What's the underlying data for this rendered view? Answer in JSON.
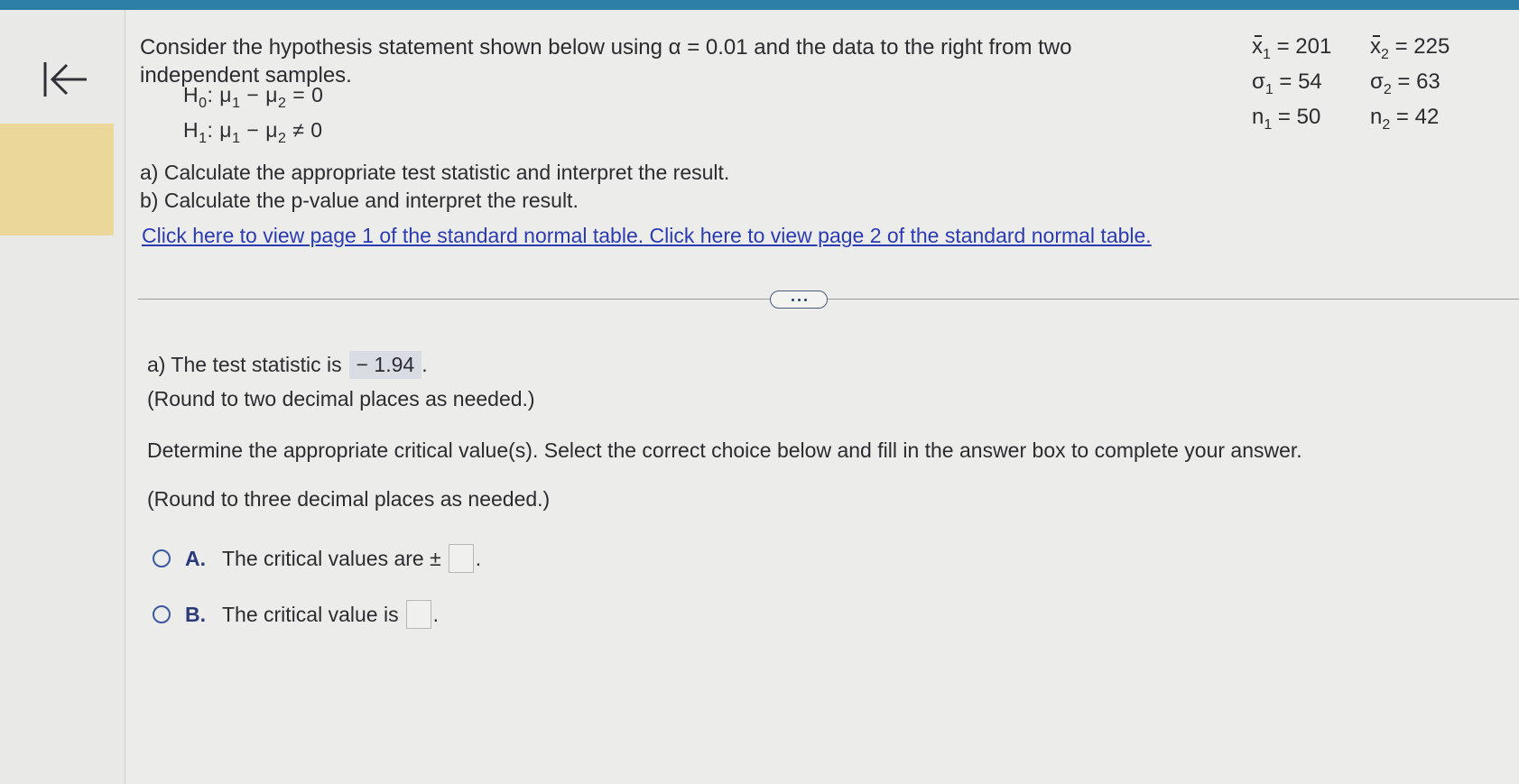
{
  "question": {
    "line1": "Consider the hypothesis statement shown below using α = 0.01 and the data to the right from two",
    "line2": "independent samples.",
    "h0_label": "H",
    "h0_sub": "0",
    "h0_rest": ": μ",
    "h0_mu1_sub": "1",
    "h0_minus": " − μ",
    "h0_mu2_sub": "2",
    "h0_eq": " = 0",
    "h1_label": "H",
    "h1_sub": "1",
    "h1_rest": ": μ",
    "h1_mu1_sub": "1",
    "h1_minus": " − μ",
    "h1_mu2_sub": "2",
    "h1_eq": " ≠ 0",
    "part_a": "Calculate the appropriate test statistic and interpret the result.",
    "part_a_label": "a)",
    "part_b": "Calculate the p-value and interpret the result.",
    "part_b_label": "b)",
    "link1": "Click here to view page 1 of the standard normal table.",
    "link2": "Click here to view page 2 of the standard normal table."
  },
  "sample_data": {
    "x1": {
      "sym": "x",
      "sub": "1",
      "val": " = 201"
    },
    "x2": {
      "sym": "x",
      "sub": "2",
      "val": " = 225"
    },
    "s1": {
      "sym": "σ",
      "sub": "1",
      "val": " = 54"
    },
    "s2": {
      "sym": "σ",
      "sub": "2",
      "val": " = 63"
    },
    "n1": {
      "sym": "n",
      "sub": "1",
      "val": " = 50"
    },
    "n2": {
      "sym": "n",
      "sub": "2",
      "val": " = 42"
    }
  },
  "answer_a": {
    "prefix": "a) The test statistic is",
    "value": "− 1.94",
    "suffix": ".",
    "note": "(Round to two decimal places as needed.)"
  },
  "critical": {
    "instruction": "Determine the appropriate critical value(s). Select the correct choice below and fill in the answer box to complete your answer.",
    "note": "(Round to three decimal places as needed.)",
    "choice_a_letter": "A.",
    "choice_a_text": "The critical values are ±",
    "choice_b_letter": "B.",
    "choice_b_text": "The critical value is",
    "period": "."
  },
  "colors": {
    "accent_bar": "#2e7fa8",
    "link": "#2b3bb0",
    "highlight": "#ecd79a"
  }
}
